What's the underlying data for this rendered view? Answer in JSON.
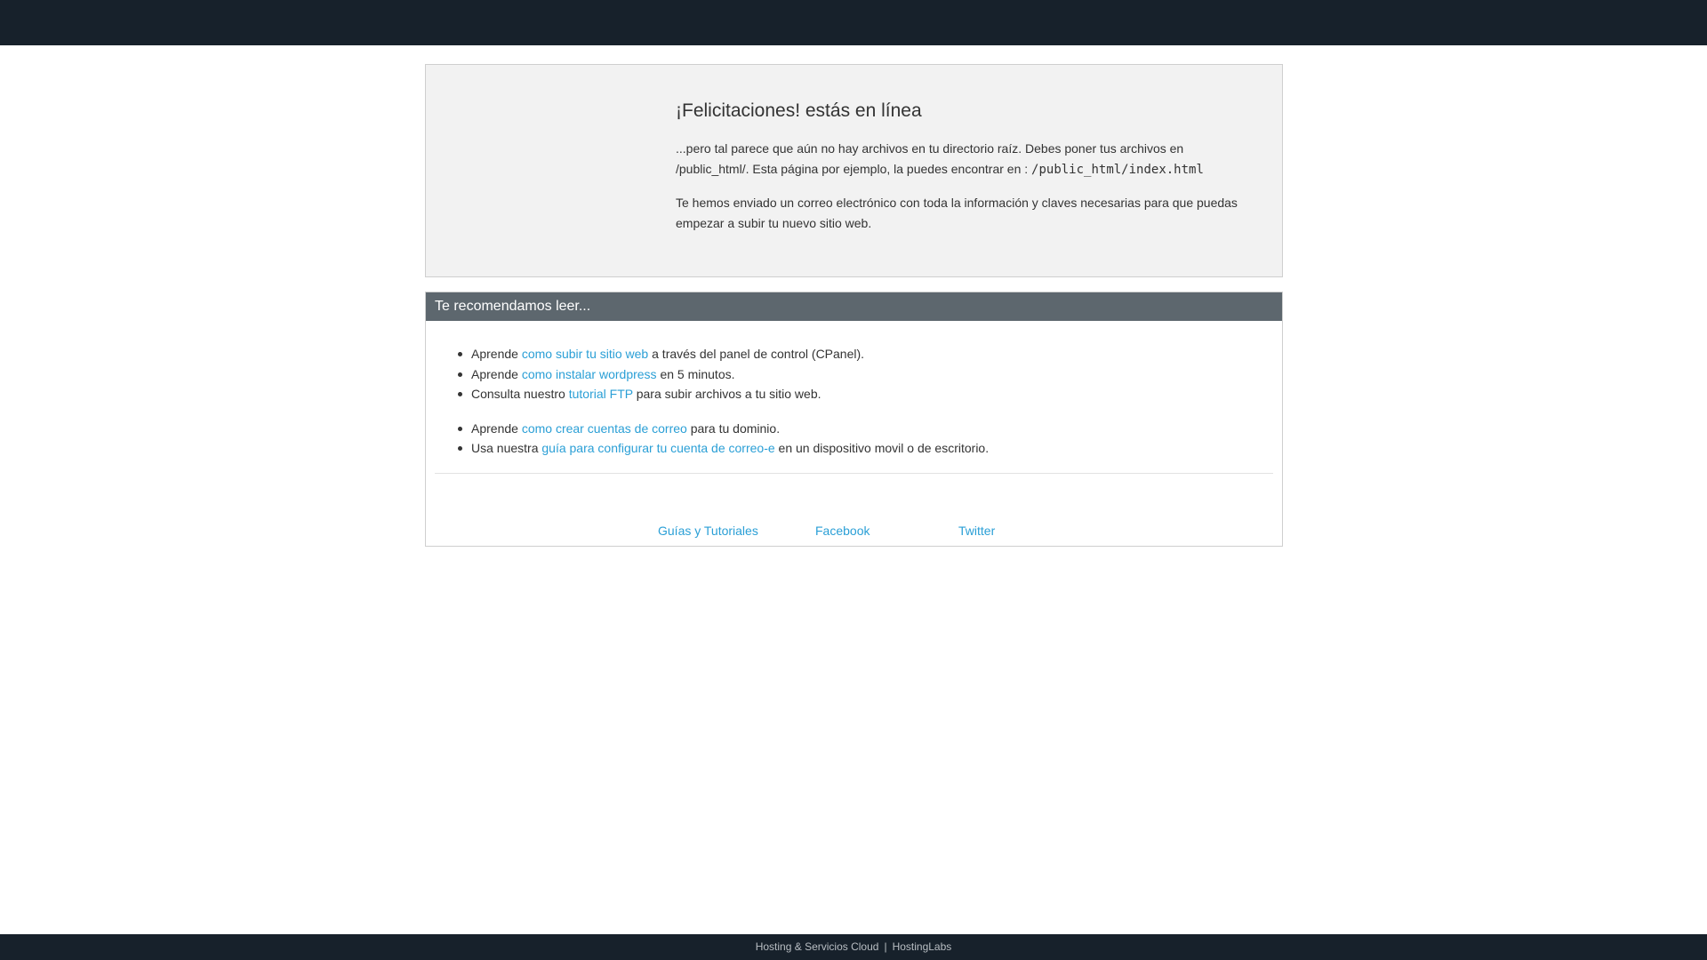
{
  "hero": {
    "title": "¡Felicitaciones! estás en línea",
    "paragraph1_text": "...pero tal parece que aún no hay archivos en tu directorio raíz. Debes poner tus archivos en /public_html/. Esta página por ejemplo, la puedes encontrar en : ",
    "paragraph1_code": "/public_html/index.html",
    "paragraph2": "Te hemos enviado un correo electrónico con toda la información y claves necesarias para que puedas empezar a subir tu nuevo sitio web."
  },
  "recommend": {
    "header": "Te recomendamos leer...",
    "list1": [
      {
        "before": "Aprende ",
        "link": "como subir tu sitio web",
        "after": " a través del panel de control (CPanel)."
      },
      {
        "before": "Aprende ",
        "link": "como instalar wordpress",
        "after": " en 5 minutos."
      },
      {
        "before": "Consulta nuestro ",
        "link": "tutorial FTP",
        "after": " para subir archivos a tu sitio web."
      }
    ],
    "list2": [
      {
        "before": "Aprende ",
        "link": "como crear cuentas de correo",
        "after": " para tu dominio."
      },
      {
        "before": "Usa nuestra ",
        "link": "guía para configurar tu cuenta de correo-e",
        "after": " en un dispositivo movil o de escritorio."
      }
    ]
  },
  "footer_links": {
    "guides": "Guías y Tutoriales",
    "facebook": "Facebook",
    "twitter": "Twitter"
  },
  "bottombar": {
    "left": "Hosting & Servicios Cloud",
    "separator": "|",
    "right": "HostingLabs"
  },
  "colors": {
    "topbar": "#17212b",
    "panel_header": "#5d676e",
    "link": "#2a9fd6",
    "hero_bg": "#f2f2f2"
  }
}
